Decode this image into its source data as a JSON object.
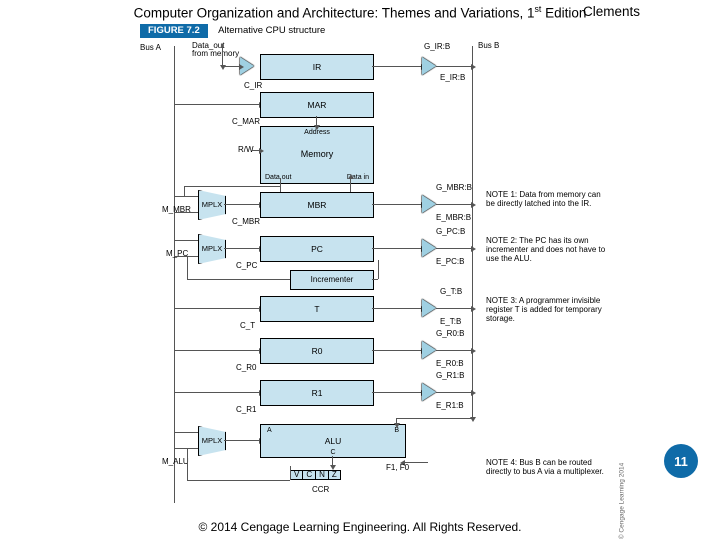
{
  "header": {
    "book_pre": "Computer Organization and Architecture: Themes and Variations, 1",
    "book_ord": "st",
    "book_post": " Edition",
    "author": "Clements"
  },
  "page_number": "11",
  "footer": "© 2014 Cengage Learning Engineering. All Rights Reserved.",
  "figure": {
    "caption_tag": "FIGURE 7.2",
    "caption_title": "Alternative CPU structure",
    "busA": "Bus A",
    "busB": "Bus B",
    "data_out": "Data_out\nfrom memory",
    "blocks": {
      "ir": "IR",
      "mar": "MAR",
      "mbr": "MBR",
      "pc": "PC",
      "incr": "Incrementer",
      "t": "T",
      "r0": "R0",
      "r1": "R1",
      "alu": "ALU",
      "ccr": "CCR",
      "mplx": "MPLX",
      "mem": "Memory",
      "addr": "Address",
      "dout": "Data out",
      "din": "Data in",
      "aluA": "A",
      "aluB": "B",
      "aluC": "C"
    },
    "sig": {
      "cir": "C_IR",
      "cmar": "C_MAR",
      "rw": "R/W",
      "mmbr": "M_MBR",
      "cmbr": "C_MBR",
      "mpc": "M_PC",
      "cpc": "C_PC",
      "ct": "C_T",
      "cr0": "C_R0",
      "cr1": "C_R1",
      "malu": "M_ALU",
      "girb": "G_IR:B",
      "eirb": "E_IR:B",
      "gmbrb": "G_MBR:B",
      "embrb": "E_MBR:B",
      "gpcb": "G_PC:B",
      "epcb": "E_PC:B",
      "gtb": "G_T:B",
      "etb": "E_T:B",
      "gr0b": "G_R0:B",
      "er0b": "E_R0:B",
      "gr1b": "G_R1:B",
      "er1b": "E_R1:B",
      "f": "F1, F0"
    },
    "ccr_bits": [
      "V",
      "C",
      "N",
      "Z"
    ],
    "notes": {
      "n1": "NOTE 1: Data from memory can be directly latched into the IR.",
      "n2": "NOTE 2: The PC has its own incrementer and does not have to use the ALU.",
      "n3": "NOTE 3: A programmer invisible register T is added for temporary storage.",
      "n4": "NOTE 4: Bus B can be routed directly to bus A via a multiplexer."
    },
    "credit": "© Cengage Learning 2014"
  }
}
